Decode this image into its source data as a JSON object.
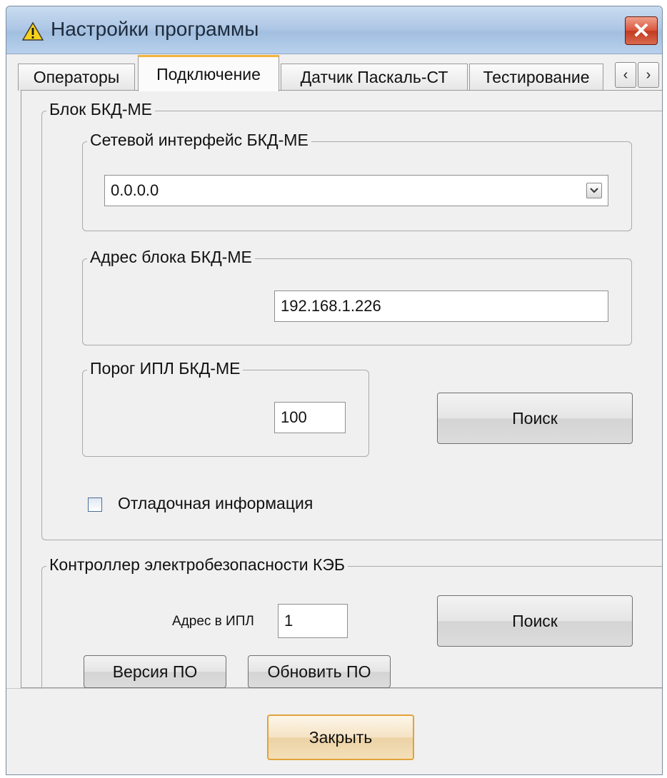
{
  "window": {
    "title": "Настройки программы",
    "close_label": "✕"
  },
  "tabs": [
    {
      "label": "Операторы",
      "active": false
    },
    {
      "label": "Подключение",
      "active": true
    },
    {
      "label": "Датчик Паскаль-СТ",
      "active": false
    },
    {
      "label": "Тестирование",
      "active": false
    }
  ],
  "tab_scroll": {
    "left": "‹",
    "right": "›"
  },
  "bkd_group": {
    "legend": "Блок БКД-МЕ",
    "network_interface": {
      "legend": "Сетевой интерфейс БКД-МЕ",
      "selected_value": "0.0.0.0"
    },
    "address": {
      "legend": "Адрес блока БКД-МЕ",
      "value": "192.168.1.226"
    },
    "threshold": {
      "legend": "Порог ИПЛ БКД-МЕ",
      "value": "100"
    },
    "search_button": "Поиск",
    "debug_checkbox": {
      "label": "Отладочная информация",
      "checked": false
    }
  },
  "keb_group": {
    "legend": "Контроллер электробезопасности КЭБ",
    "address_label": "Адрес в ИПЛ",
    "address_value": "1",
    "search_button": "Поиск",
    "version_button": "Версия ПО",
    "update_button": "Обновить ПО"
  },
  "footer": {
    "close_button": "Закрыть"
  },
  "colors": {
    "title_bar": "#b8d0ec",
    "active_tab_accent": "#f3b33c",
    "close_button": "#d9543a",
    "default_button_border": "#e2a33a"
  }
}
